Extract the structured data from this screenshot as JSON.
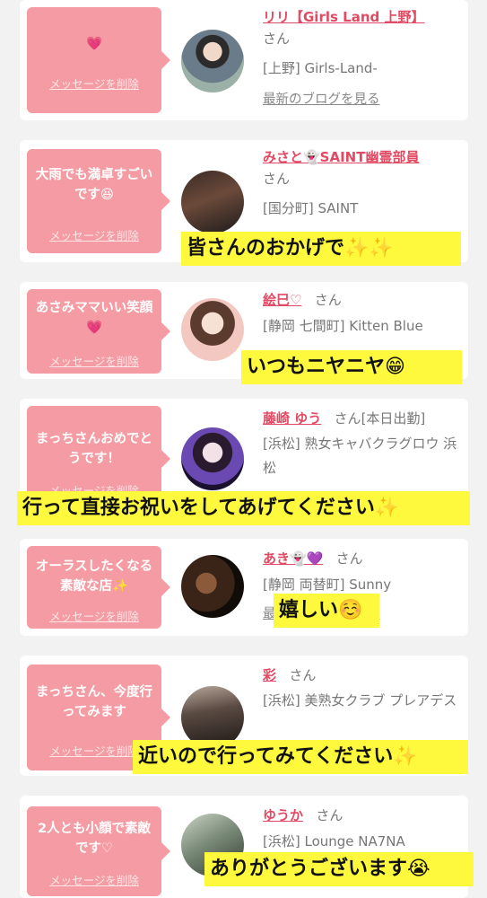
{
  "cards": [
    {
      "message": "💗",
      "delete_label": "メッセージを削除",
      "name": "リリ【Girls Land 上野】",
      "san": "さん",
      "shop": "[上野] Girls-Land-",
      "blog": "最新のブログを見る"
    },
    {
      "message": "大雨でも満卓すごいです😆",
      "delete_label": "メッセージを削除",
      "name": "みさと👻SAINT幽霊部員",
      "san": "さん",
      "shop": "[国分町] SAINT"
    },
    {
      "message": "あさみママいい笑顔💗",
      "delete_label": "メッセージを削除",
      "name": "絵巳♡",
      "san": "さん",
      "shop": "[静岡 七間町] Kitten Blue"
    },
    {
      "message": "まっちさんおめでとうです！",
      "delete_label": "メッセージを削除",
      "name": "藤崎 ゆう",
      "san": "さん",
      "status": "[本日出勤]",
      "shop": "[浜松] 熟女キャバクラグロウ 浜松"
    },
    {
      "message": "オーラスしたくなる素敵な店✨",
      "delete_label": "メッセージを削除",
      "name": "あき👻💜",
      "san": "さん",
      "shop": "[静岡 両替町] Sunny",
      "blog": "最新のブログを見る"
    },
    {
      "message": "まっちさん、今度行ってみます",
      "delete_label": "メッセージを削除",
      "name": "彩",
      "san": "さん",
      "shop": "[浜松] 美熟女クラブ プレアデス"
    },
    {
      "message": "2人とも小顔で素敵です♡",
      "delete_label": "メッセージを削除",
      "name": "ゆうか",
      "san": "さん",
      "shop": "[浜松] Lounge NA7NA"
    }
  ],
  "captions": [
    "皆さんのおかげで✨✨",
    "いつもニヤニヤ😁",
    "行って直接お祝いをしてあげてください✨",
    "嬉しい☺️",
    "近いので行ってみてください✨",
    "ありがとうございます😭"
  ]
}
